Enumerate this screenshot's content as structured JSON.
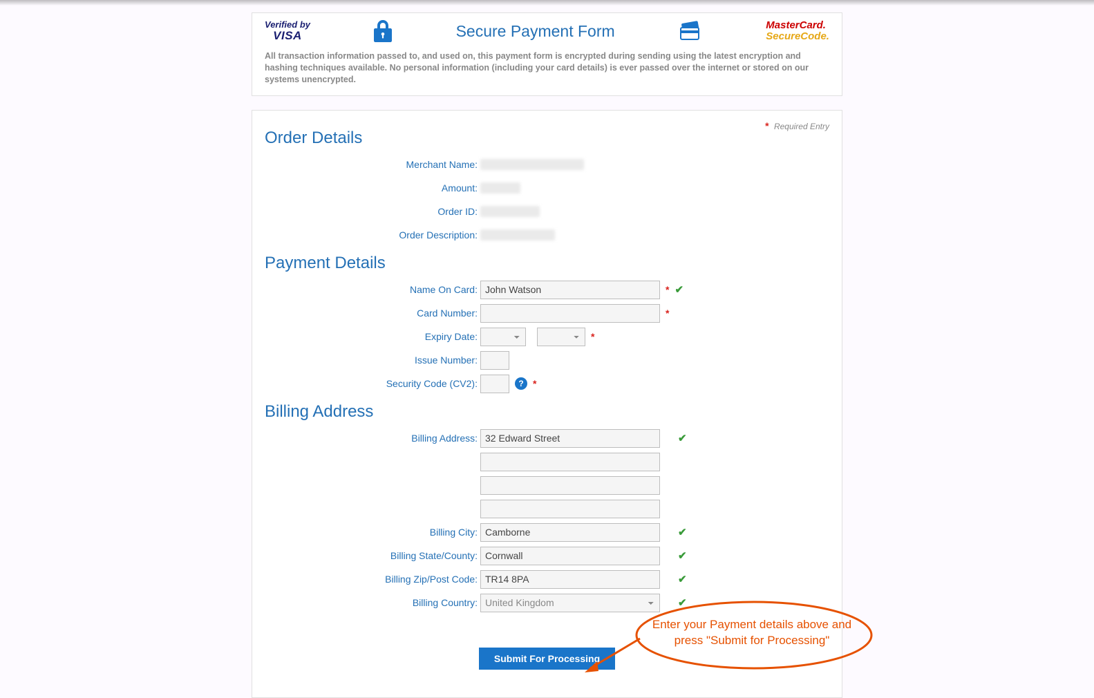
{
  "header": {
    "visa_line1": "Verified by",
    "visa_line2": "VISA",
    "title": "Secure Payment Form",
    "mc_line1": "MasterCard.",
    "mc_line2": "SecureCode.",
    "description": "All transaction information passed to, and used on, this payment form is encrypted during sending using the latest encryption and hashing techniques available. No personal information (including your card details) is ever passed over the internet or stored on our systems unencrypted."
  },
  "required_note": "Required Entry",
  "sections": {
    "order": {
      "title": "Order Details",
      "labels": {
        "merchant": "Merchant Name:",
        "amount": "Amount:",
        "order_id": "Order ID:",
        "order_desc": "Order Description:"
      }
    },
    "payment": {
      "title": "Payment Details",
      "labels": {
        "name_on_card": "Name On Card:",
        "card_number": "Card Number:",
        "expiry": "Expiry Date:",
        "issue": "Issue Number:",
        "cv2": "Security Code (CV2):"
      },
      "values": {
        "name_on_card": "John Watson",
        "card_number": "",
        "expiry_month": "",
        "expiry_year": "",
        "issue": "",
        "cv2": ""
      }
    },
    "billing": {
      "title": "Billing Address",
      "labels": {
        "address": "Billing Address:",
        "city": "Billing City:",
        "state": "Billing State/County:",
        "zip": "Billing Zip/Post Code:",
        "country": "Billing Country:"
      },
      "values": {
        "address1": "32 Edward Street",
        "address2": "",
        "address3": "",
        "address4": "",
        "city": "Camborne",
        "state": "Cornwall",
        "zip": "TR14 8PA",
        "country": "United Kingdom"
      }
    }
  },
  "submit_label": "Submit For Processing",
  "annotation_text": "Enter your Payment details above and press \"Submit for Processing\""
}
